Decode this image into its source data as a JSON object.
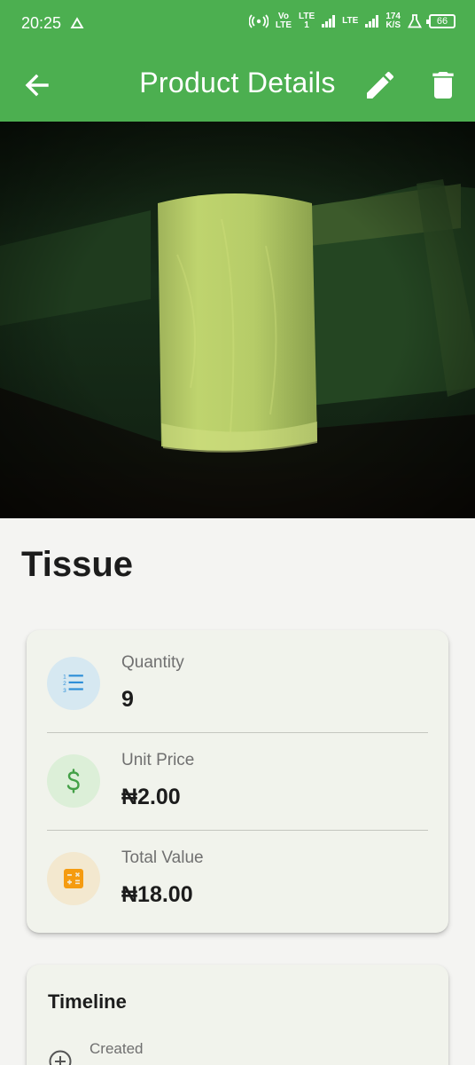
{
  "status_bar": {
    "time": "20:25",
    "volte_top": "Vo",
    "volte_bottom": "LTE",
    "lte1_top": "LTE",
    "lte1_bottom": "1",
    "lte2": "LTE",
    "speed_value": "174",
    "speed_unit": "K/S",
    "battery": "66"
  },
  "app_bar": {
    "title": "Product Details",
    "background": "#4caf50"
  },
  "product": {
    "name": "Tissue",
    "stats": [
      {
        "label": "Quantity",
        "value": "9",
        "icon": "numbered-list-icon",
        "icon_color": "#2e8fd8",
        "icon_bg": "#d6e8f1"
      },
      {
        "label": "Unit Price",
        "value": "₦2.00",
        "icon": "dollar-icon",
        "icon_color": "#43a047",
        "icon_bg": "#dcefd8"
      },
      {
        "label": "Total Value",
        "value": "₦18.00",
        "icon": "calculator-icon",
        "icon_color": "#f59b10",
        "icon_bg": "#f3e8cf"
      }
    ]
  },
  "timeline": {
    "title": "Timeline",
    "items": [
      {
        "label": "Created",
        "icon": "add-circle-icon"
      }
    ]
  }
}
